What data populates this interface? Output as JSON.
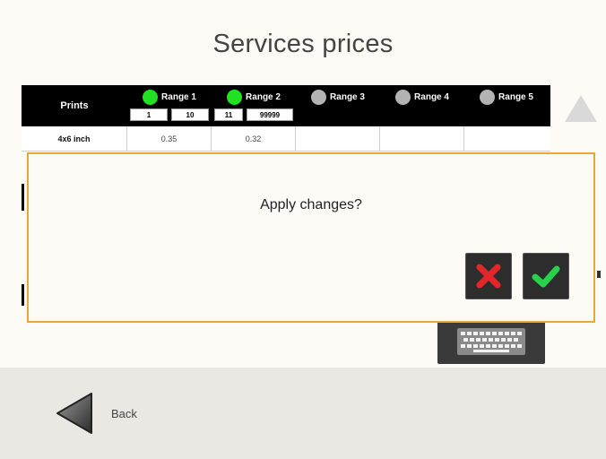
{
  "page": {
    "title": "Services prices"
  },
  "table": {
    "header_label": "Prints",
    "ranges": [
      {
        "label": "Range 1",
        "active": true,
        "from": "1",
        "to": "10"
      },
      {
        "label": "Range 2",
        "active": true,
        "from": "11",
        "to": "99999"
      },
      {
        "label": "Range 3",
        "active": false
      },
      {
        "label": "Range 4",
        "active": false
      },
      {
        "label": "Range 5",
        "active": false
      }
    ],
    "rows": [
      {
        "label": "4x6 inch",
        "prices": [
          "0.35",
          "0.32",
          "",
          "",
          ""
        ]
      }
    ]
  },
  "dialog": {
    "message": "Apply changes?",
    "cancel_icon": "x-icon",
    "confirm_icon": "check-icon"
  },
  "footer": {
    "back_label": "Back"
  },
  "colors": {
    "accent_border": "#e7a83a",
    "active_dot": "#22e022",
    "inactive_dot": "#b3b3b3",
    "cancel_red": "#e3262a",
    "confirm_green": "#27d14a"
  }
}
